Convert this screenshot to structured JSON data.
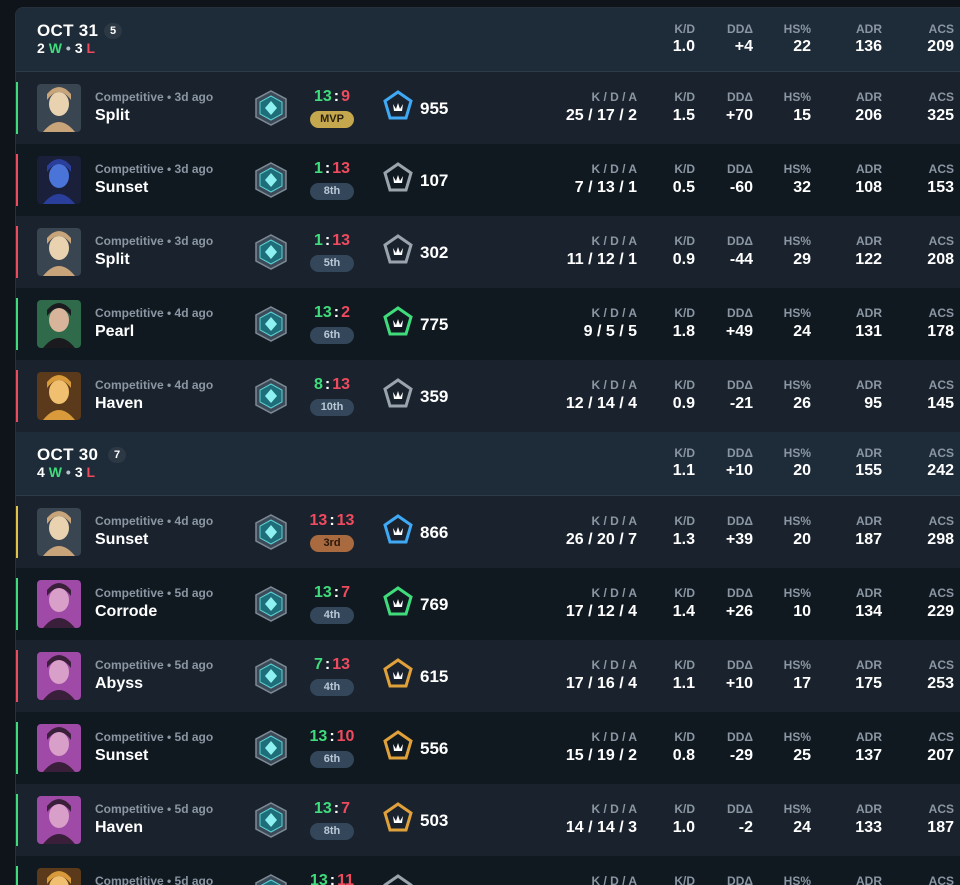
{
  "days": [
    {
      "date": "OCT 31",
      "count": "5",
      "wins": "2",
      "w": "W",
      "losses": "3",
      "l": "L",
      "kd": "1.0",
      "dd": "+4",
      "hs": "22",
      "adr": "136",
      "acs": "209",
      "labels": {
        "kd": "K/D",
        "dd": "DDΔ",
        "hs": "HS%",
        "adr": "ADR",
        "acs": "ACS"
      }
    },
    {
      "date": "OCT 30",
      "count": "7",
      "wins": "4",
      "w": "W",
      "losses": "3",
      "l": "L",
      "kd": "1.1",
      "dd": "+10",
      "hs": "20",
      "adr": "155",
      "acs": "242",
      "labels": {
        "kd": "K/D",
        "dd": "DDΔ",
        "hs": "HS%",
        "adr": "ADR",
        "acs": "ACS"
      }
    }
  ],
  "stat_labels": {
    "kda": "K / D / A",
    "kd": "K/D",
    "dd": "DDΔ",
    "hs": "HS%",
    "adr": "ADR",
    "acs": "ACS"
  },
  "matches": [
    {
      "mode": "Competitive • 3d ago",
      "map": "Split",
      "agent": "agent-portrait-blond",
      "score_a": "13",
      "score_b": "9",
      "result": "win",
      "placement": "MVP",
      "tier_color": "#3fa9f5",
      "rr": "955",
      "kda": "25 / 17 / 2",
      "kd": "1.5",
      "dd": "+70",
      "hs": "15",
      "adr": "206",
      "acs": "325"
    },
    {
      "mode": "Competitive • 3d ago",
      "map": "Sunset",
      "agent": "agent-portrait-blue",
      "score_a": "1",
      "score_b": "13",
      "result": "loss",
      "placement": "8th",
      "tier_color": "#9aa4ad",
      "rr": "107",
      "kda": "7 / 13 / 1",
      "kd": "0.5",
      "dd": "-60",
      "hs": "32",
      "adr": "108",
      "acs": "153"
    },
    {
      "mode": "Competitive • 3d ago",
      "map": "Split",
      "agent": "agent-portrait-blond",
      "score_a": "1",
      "score_b": "13",
      "result": "loss",
      "placement": "5th",
      "tier_color": "#9aa4ad",
      "rr": "302",
      "kda": "11 / 12 / 1",
      "kd": "0.9",
      "dd": "-44",
      "hs": "29",
      "adr": "122",
      "acs": "208"
    },
    {
      "mode": "Competitive • 4d ago",
      "map": "Pearl",
      "agent": "agent-portrait-dark",
      "score_a": "13",
      "score_b": "2",
      "result": "win",
      "placement": "6th",
      "tier_color": "#3fdc7c",
      "rr": "775",
      "kda": "9 / 5 / 5",
      "kd": "1.8",
      "dd": "+49",
      "hs": "24",
      "adr": "131",
      "acs": "178"
    },
    {
      "mode": "Competitive • 4d ago",
      "map": "Haven",
      "agent": "agent-portrait-gold",
      "score_a": "8",
      "score_b": "13",
      "result": "loss",
      "placement": "10th",
      "tier_color": "#9aa4ad",
      "rr": "359",
      "kda": "12 / 14 / 4",
      "kd": "0.9",
      "dd": "-21",
      "hs": "26",
      "adr": "95",
      "acs": "145"
    },
    {
      "mode": "Competitive • 4d ago",
      "map": "Sunset",
      "agent": "agent-portrait-blond",
      "score_a": "13",
      "score_b": "13",
      "result": "draw",
      "placement": "3rd",
      "tier_color": "#3fa9f5",
      "rr": "866",
      "kda": "26 / 20 / 7",
      "kd": "1.3",
      "dd": "+39",
      "hs": "20",
      "adr": "187",
      "acs": "298"
    },
    {
      "mode": "Competitive • 5d ago",
      "map": "Corrode",
      "agent": "agent-portrait-purple",
      "score_a": "13",
      "score_b": "7",
      "result": "win",
      "placement": "4th",
      "tier_color": "#3fdc7c",
      "rr": "769",
      "kda": "17 / 12 / 4",
      "kd": "1.4",
      "dd": "+26",
      "hs": "10",
      "adr": "134",
      "acs": "229"
    },
    {
      "mode": "Competitive • 5d ago",
      "map": "Abyss",
      "agent": "agent-portrait-purple",
      "score_a": "7",
      "score_b": "13",
      "result": "loss",
      "placement": "4th",
      "tier_color": "#e0a13a",
      "rr": "615",
      "kda": "17 / 16 / 4",
      "kd": "1.1",
      "dd": "+10",
      "hs": "17",
      "adr": "175",
      "acs": "253"
    },
    {
      "mode": "Competitive • 5d ago",
      "map": "Sunset",
      "agent": "agent-portrait-purple",
      "score_a": "13",
      "score_b": "10",
      "result": "win",
      "placement": "6th",
      "tier_color": "#e0a13a",
      "rr": "556",
      "kda": "15 / 19 / 2",
      "kd": "0.8",
      "dd": "-29",
      "hs": "25",
      "adr": "137",
      "acs": "207"
    },
    {
      "mode": "Competitive • 5d ago",
      "map": "Haven",
      "agent": "agent-portrait-purple",
      "score_a": "13",
      "score_b": "7",
      "result": "win",
      "placement": "8th",
      "tier_color": "#e0a13a",
      "rr": "503",
      "kda": "14 / 14 / 3",
      "kd": "1.0",
      "dd": "-2",
      "hs": "24",
      "adr": "133",
      "acs": "187"
    },
    {
      "mode": "Competitive • 5d ago",
      "map": "",
      "agent": "agent-portrait-gold",
      "score_a": "13",
      "score_b": "11",
      "result": "win",
      "placement": "",
      "tier_color": "#9aa4ad",
      "rr": "",
      "kda": "",
      "kd": "",
      "dd": "",
      "hs": "",
      "adr": "",
      "acs": ""
    }
  ],
  "colors": {
    "win": "#3fdc7c",
    "loss": "#ef4a5e",
    "draw": "#e0c44a",
    "header_bg": "#1e2b38"
  }
}
